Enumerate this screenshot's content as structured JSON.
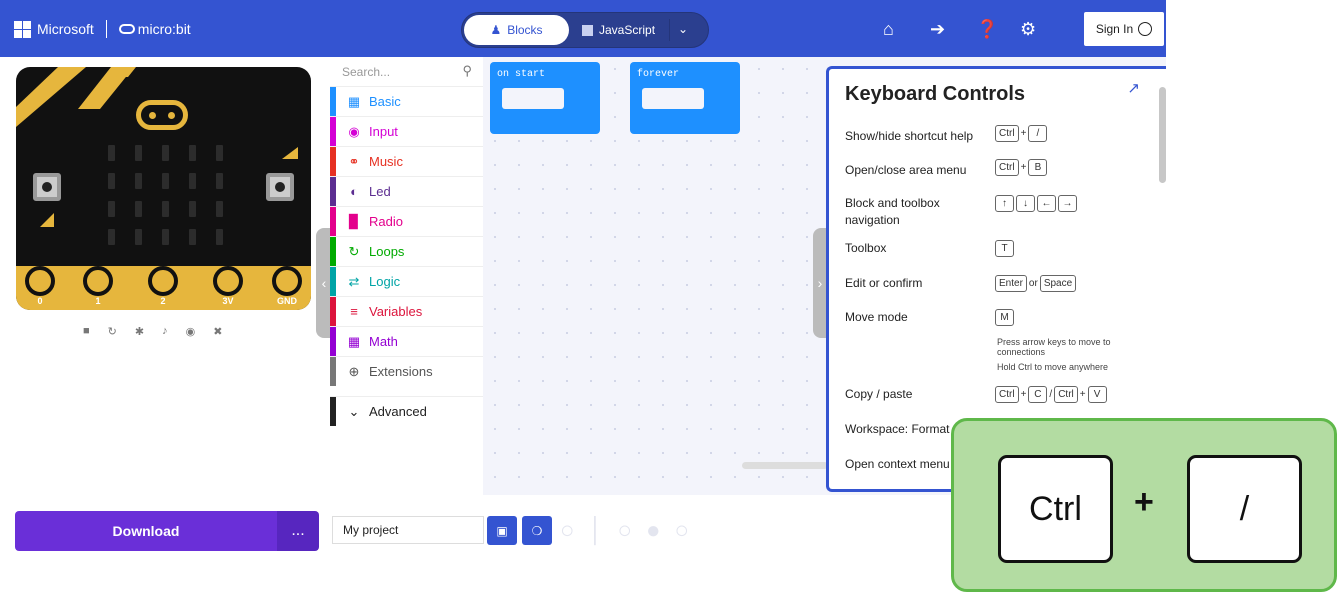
{
  "header": {
    "brand": "Microsoft",
    "product": "micro:bit",
    "tabs": {
      "blocks": "Blocks",
      "javascript": "JavaScript"
    },
    "sign_in": "Sign In",
    "icons": [
      "home-icon",
      "share-icon",
      "help-icon",
      "settings-icon"
    ],
    "accent": "#3454d1"
  },
  "simulator": {
    "pins": [
      "0",
      "1",
      "2",
      "3V",
      "GND"
    ],
    "buttons": {
      "a": "A",
      "b": "B"
    },
    "controls": [
      "stop-icon",
      "restart-icon",
      "slowmo-icon",
      "mute-icon",
      "screenshot-icon",
      "fullscreen-icon"
    ]
  },
  "toolbox": {
    "search_placeholder": "Search...",
    "categories": [
      {
        "label": "Basic",
        "color": "#1e90ff",
        "icon": "grid-icon"
      },
      {
        "label": "Input",
        "color": "#d400d4",
        "icon": "input-icon"
      },
      {
        "label": "Music",
        "color": "#e63022",
        "icon": "headphones-icon"
      },
      {
        "label": "Led",
        "color": "#5c2d91",
        "icon": "toggle-icon"
      },
      {
        "label": "Radio",
        "color": "#e3008c",
        "icon": "signal-icon"
      },
      {
        "label": "Loops",
        "color": "#00aa00",
        "icon": "loop-icon"
      },
      {
        "label": "Logic",
        "color": "#00a4a6",
        "icon": "shuffle-icon"
      },
      {
        "label": "Variables",
        "color": "#dc143c",
        "icon": "lines-icon"
      },
      {
        "label": "Math",
        "color": "#9400d3",
        "icon": "calculator-icon"
      },
      {
        "label": "Extensions",
        "color": "#777777",
        "icon": "plus-icon"
      },
      {
        "label": "Advanced",
        "color": "#222222",
        "icon": "chevron-down-icon"
      }
    ]
  },
  "workspace": {
    "blocks": [
      {
        "label": "on start"
      },
      {
        "label": "forever"
      }
    ]
  },
  "keyboard_controls": {
    "title": "Keyboard Controls",
    "rows": [
      {
        "label": "Show/hide shortcut help",
        "keys": "Ctrl + /"
      },
      {
        "label": "Open/close area menu",
        "keys": "Ctrl + B"
      },
      {
        "label": "Block and toolbox navigation",
        "keys": "↑ ↓ ← →"
      },
      {
        "label": "Toolbox",
        "keys": "T"
      },
      {
        "label": "Edit or confirm",
        "keys": "Enter or Space"
      },
      {
        "label": "Move mode",
        "keys": "M"
      },
      {
        "label": "Copy / paste",
        "keys": "Ctrl + C / Ctrl + V"
      },
      {
        "label": "Workspace: Format",
        "keys": ""
      },
      {
        "label": "Open context menu",
        "keys": ""
      }
    ],
    "move_note_1": "Press arrow keys to move to connections",
    "move_note_2": "Hold Ctrl to move anywhere",
    "key_labels": {
      "ctrl": "Ctrl",
      "slash": "/",
      "b": "B",
      "t": "T",
      "enter": "Enter",
      "or": "or",
      "space": "Space",
      "m": "M",
      "c": "C",
      "v": "V",
      "up": "↑",
      "down": "↓",
      "left": "←",
      "right": "→",
      "plus": "+"
    }
  },
  "footer": {
    "download": "Download",
    "more": "...",
    "project_name": "My project"
  },
  "overlay": {
    "key1": "Ctrl",
    "plus": "+",
    "key2": "/"
  }
}
